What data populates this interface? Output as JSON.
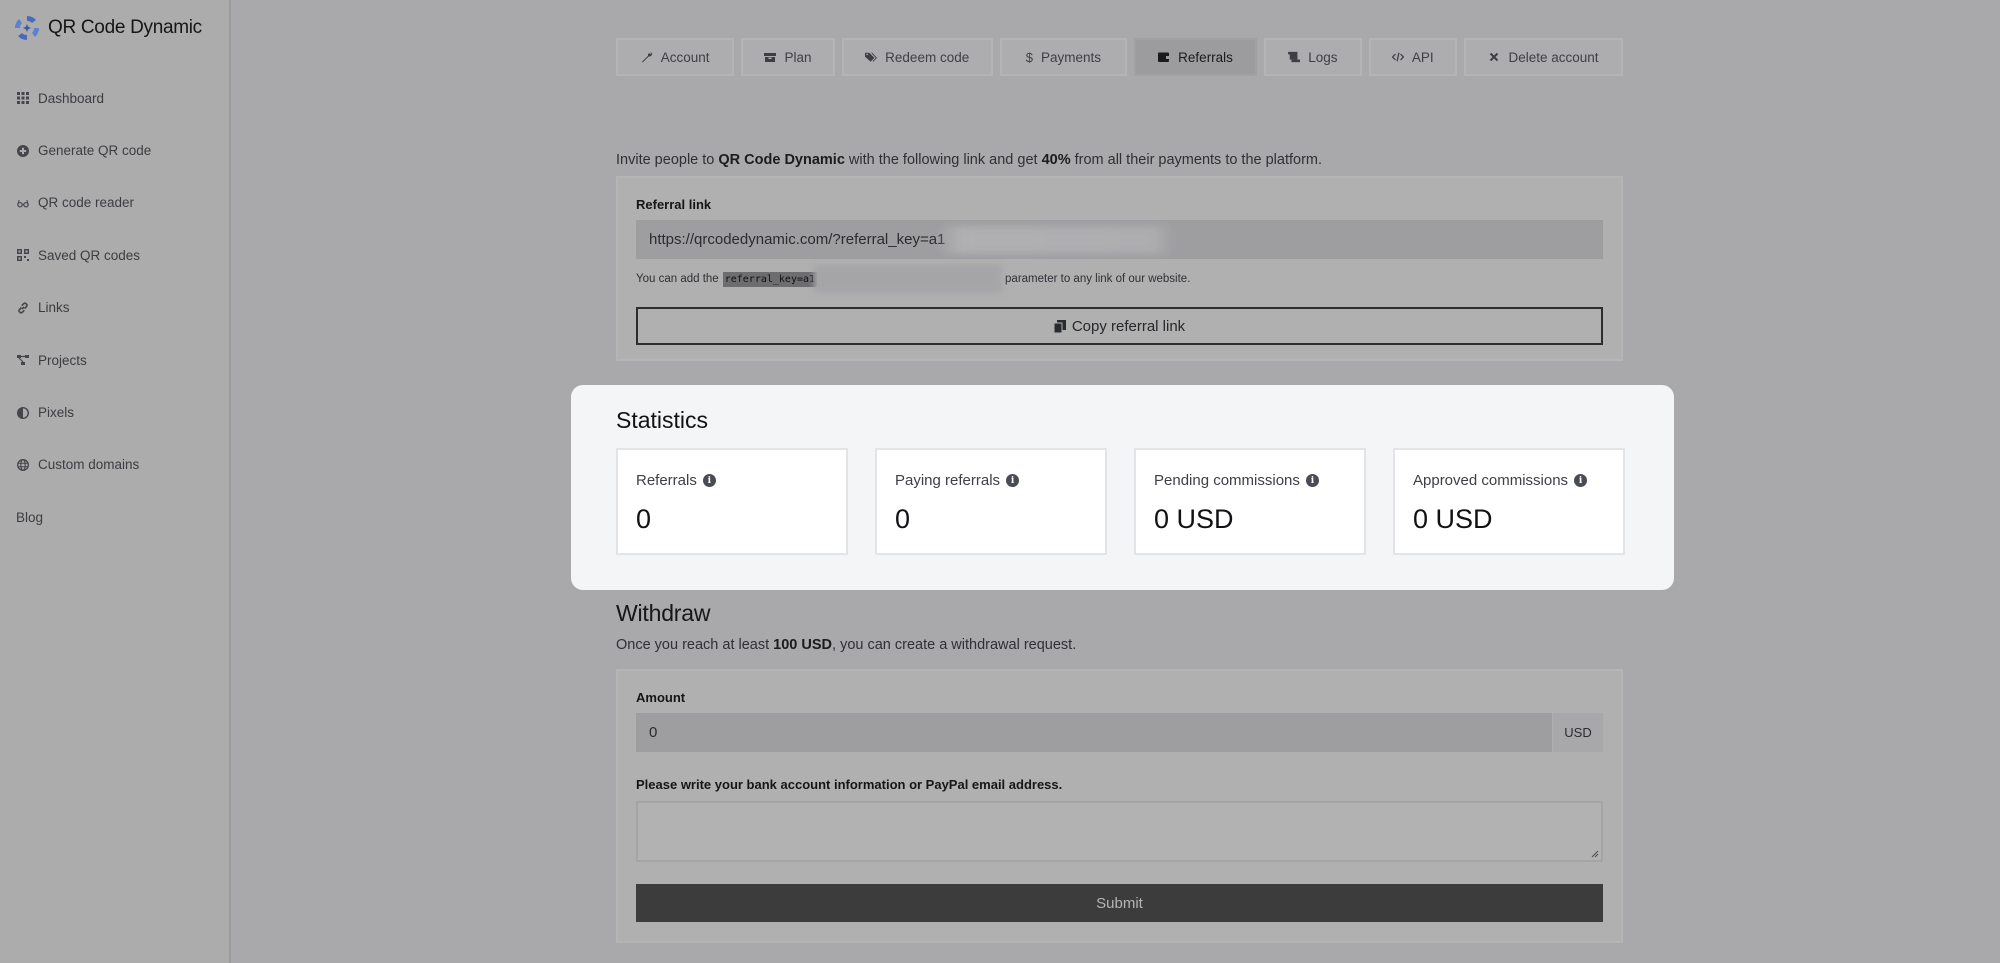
{
  "app": {
    "name": "QR Code Dynamic",
    "logo_icon": "qr-dynamic-logo"
  },
  "sidebar": {
    "items": [
      {
        "label": "Dashboard",
        "icon": "grid-icon"
      },
      {
        "label": "Generate QR code",
        "icon": "plus-circle-icon"
      },
      {
        "label": "QR code reader",
        "icon": "glasses-icon"
      },
      {
        "label": "Saved QR codes",
        "icon": "qr-icon"
      },
      {
        "label": "Links",
        "icon": "link-icon"
      },
      {
        "label": "Projects",
        "icon": "project-diagram-icon"
      },
      {
        "label": "Pixels",
        "icon": "adjust-icon"
      },
      {
        "label": "Custom domains",
        "icon": "globe-icon"
      },
      {
        "label": "Blog",
        "icon": ""
      }
    ]
  },
  "tabs": [
    {
      "label": "Account",
      "icon": "wrench-icon",
      "active": false
    },
    {
      "label": "Plan",
      "icon": "box-icon",
      "active": false
    },
    {
      "label": "Redeem code",
      "icon": "tags-icon",
      "active": false
    },
    {
      "label": "Payments",
      "icon": "dollar-icon",
      "active": false
    },
    {
      "label": "Referrals",
      "icon": "wallet-icon",
      "active": true
    },
    {
      "label": "Logs",
      "icon": "scroll-icon",
      "active": false
    },
    {
      "label": "API",
      "icon": "code-icon",
      "active": false
    },
    {
      "label": "Delete account",
      "icon": "times-icon",
      "active": false
    }
  ],
  "invite": {
    "title": "Invite people",
    "lead_prefix": "Invite people to ",
    "lead_brand": "QR Code Dynamic",
    "lead_middle": " with the following link and get ",
    "lead_percent": "40%",
    "lead_suffix": " from all their payments to the platform.",
    "referral_label": "Referral link",
    "referral_value": "https://qrcodedynamic.com/?referral_key=a1",
    "hint_prefix": "You can add the",
    "hint_code": "referral_key=a1",
    "hint_suffix": "parameter to any link of our website.",
    "copy_button": "Copy referral link"
  },
  "statistics": {
    "title": "Statistics",
    "cards": [
      {
        "label": "Referrals",
        "value": "0"
      },
      {
        "label": "Paying referrals",
        "value": "0"
      },
      {
        "label": "Pending commissions",
        "value": "0 USD"
      },
      {
        "label": "Approved commissions",
        "value": "0 USD"
      }
    ]
  },
  "withdraw": {
    "title": "Withdraw",
    "lead_prefix": "Once you reach at least ",
    "lead_amount": "100 USD",
    "lead_suffix": ", you can create a withdrawal request.",
    "amount_label": "Amount",
    "amount_value": "0",
    "amount_currency": "USD",
    "details_label": "Please write your bank account information or PayPal email address.",
    "details_value": "",
    "submit": "Submit"
  }
}
